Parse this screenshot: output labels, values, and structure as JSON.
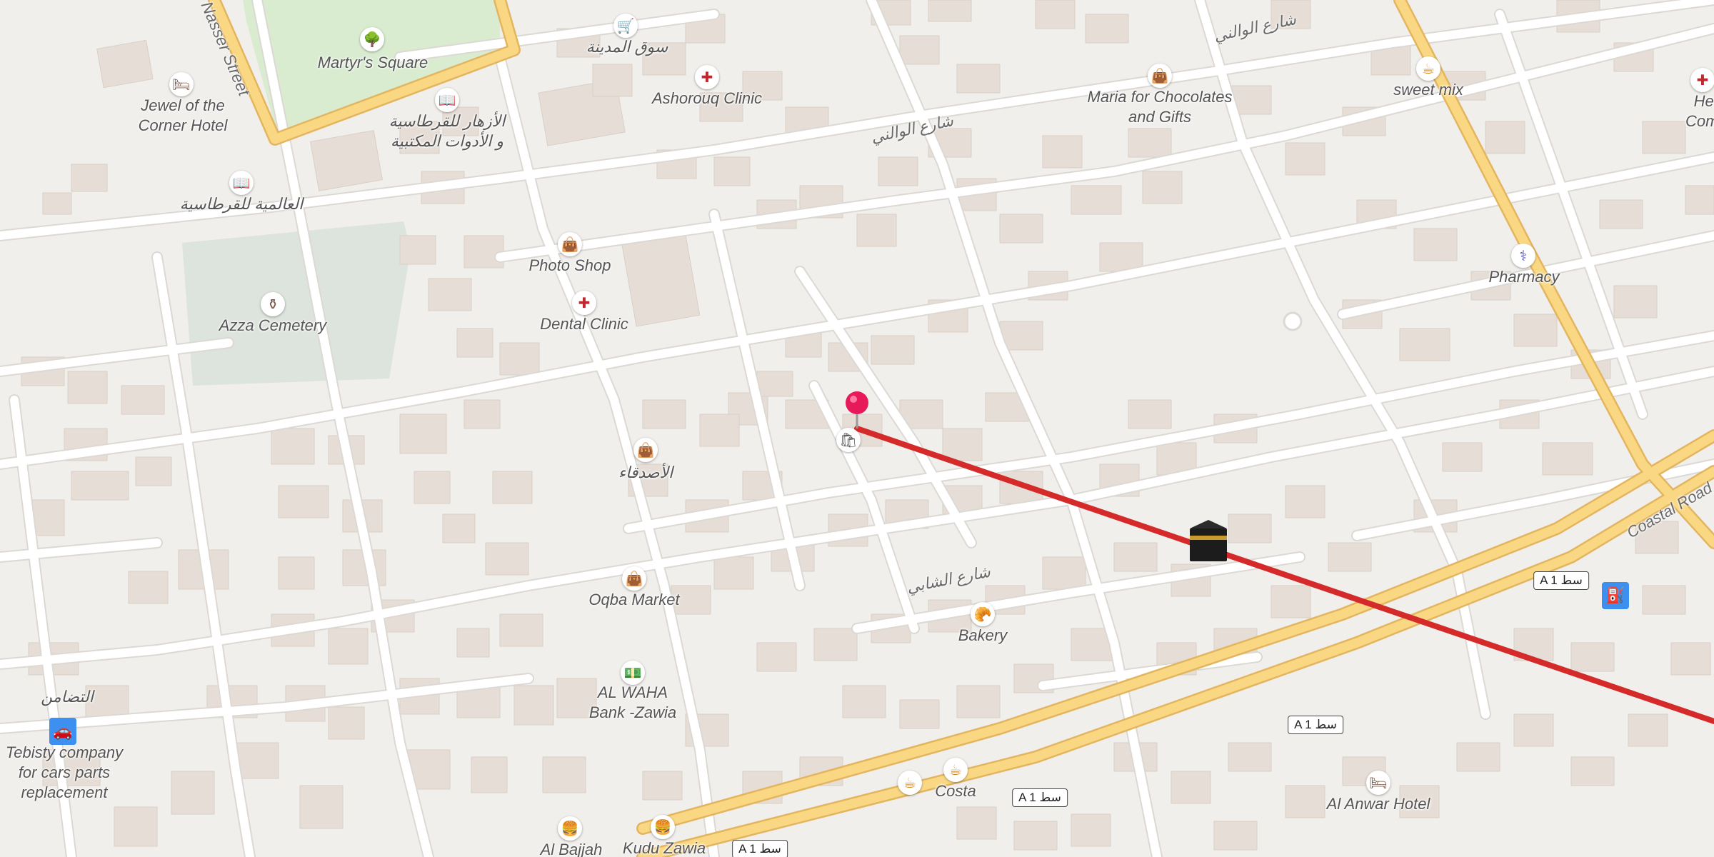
{
  "map": {
    "colors": {
      "land": "#f1efec",
      "building": "#e6ded6",
      "road": "#ffffff",
      "road_edge": "#dcd8d4",
      "major_road": "#fad883",
      "major_road_edge": "#e3b55f",
      "park": "#d9ecd0",
      "cemetery": "#dde3dd",
      "route": "#d42a2a",
      "pin": "#e8195a"
    },
    "labels": {
      "street_nasser": "Nasser Street",
      "martyrs_square": "Martyr's Square",
      "jewel_hotel": "Jewel of the\nCorner Hotel",
      "souq_almadina": "سوق المدينة",
      "ashorouq_clinic": "Ashorouq Clinic",
      "alazhar_stationery": "الأزهار للقرطاسية\nو الأدوات المكتبية",
      "alalamia_stationery": "العالمية للقرطاسية",
      "street_alwalani_top": "شارع الوالني",
      "street_alwalani_mid": "شارع الوالني",
      "maria_chocolates": "Maria for Chocolates\nand Gifts",
      "sweet_mix": "sweet mix",
      "health_complex": "Health\nComplex",
      "photo_shop": "Photo Shop",
      "pharmacy": "Pharmacy",
      "azza_cemetery": "Azza Cemetery",
      "dental_clinic": "Dental Clinic",
      "alasdiqaa": "الأصدقاء",
      "street_shashabi": "شارع الشابي",
      "oqba_market": "Oqba Market",
      "bakery": "Bakery",
      "altadamon": "التضامن",
      "tebisty": "Tebisty company\nfor cars parts\nreplacement",
      "alwaha_bank": "AL WAHA\nBank -Zawia",
      "costa": "Costa",
      "al_anwar_hotel": "Al Anwar Hotel",
      "al_bajjah": "Al Bajjah",
      "kudu_zawia": "Kudu Zawia",
      "coastal_road": "Coastal Road"
    },
    "shields": {
      "a1_right": "A 1 سط",
      "a1_mid": "A 1 سط",
      "a1_lower": "A 1 سط",
      "a1_bottom": "A 1 سط"
    },
    "icons": {
      "park": "tree-icon",
      "hotel": "bed-icon",
      "shop": "shopping-bag-icon",
      "cart": "shopping-cart-icon",
      "clinic": "medical-cross-icon",
      "books": "book-icon",
      "cafe": "coffee-cup-icon",
      "pharmacy": "pharmacy-icon",
      "cemetery": "cemetery-icon",
      "bakery": "croissant-icon",
      "bank": "bank-note-icon",
      "fast_food": "burger-icon",
      "car": "car-icon",
      "fuel": "fuel-pump-icon",
      "kaaba": "kaaba-icon",
      "place": "pushpin-icon"
    }
  }
}
